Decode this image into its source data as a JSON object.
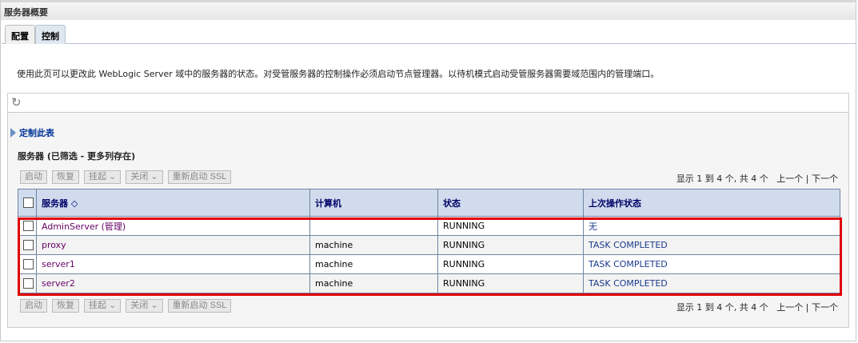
{
  "title": "服务器概要",
  "tabs": [
    {
      "label": "配置"
    },
    {
      "label": "控制"
    }
  ],
  "description": "使用此页可以更改此 WebLogic Server 域中的服务器的状态。对受管服务器的控制操作必须启动节点管理器。以待机模式启动受管服务器需要域范围内的管理端口。",
  "customize": "定制此表",
  "table_title": "服务器 (已筛选 - 更多列存在)",
  "buttons": {
    "start": "启动",
    "resume": "恢复",
    "suspend": "挂起 ⌄",
    "shutdown": "关闭 ⌄",
    "restart_ssl": "重新启动 SSL"
  },
  "pager": {
    "info": "显示 1 到 4 个, 共 4 个",
    "prev": "上一个",
    "sep": "|",
    "next": "下一个"
  },
  "columns": {
    "server": "服务器 ◇",
    "machine": "计算机",
    "state": "状态",
    "last_action": "上次操作状态"
  },
  "rows": [
    {
      "server": "AdminServer (管理)",
      "machine": "",
      "state": "RUNNING",
      "last_action": "无"
    },
    {
      "server": "proxy",
      "machine": "machine",
      "state": "RUNNING",
      "last_action": "TASK COMPLETED"
    },
    {
      "server": "server1",
      "machine": "machine",
      "state": "RUNNING",
      "last_action": "TASK COMPLETED"
    },
    {
      "server": "server2",
      "machine": "machine",
      "state": "RUNNING",
      "last_action": "TASK COMPLETED"
    }
  ]
}
